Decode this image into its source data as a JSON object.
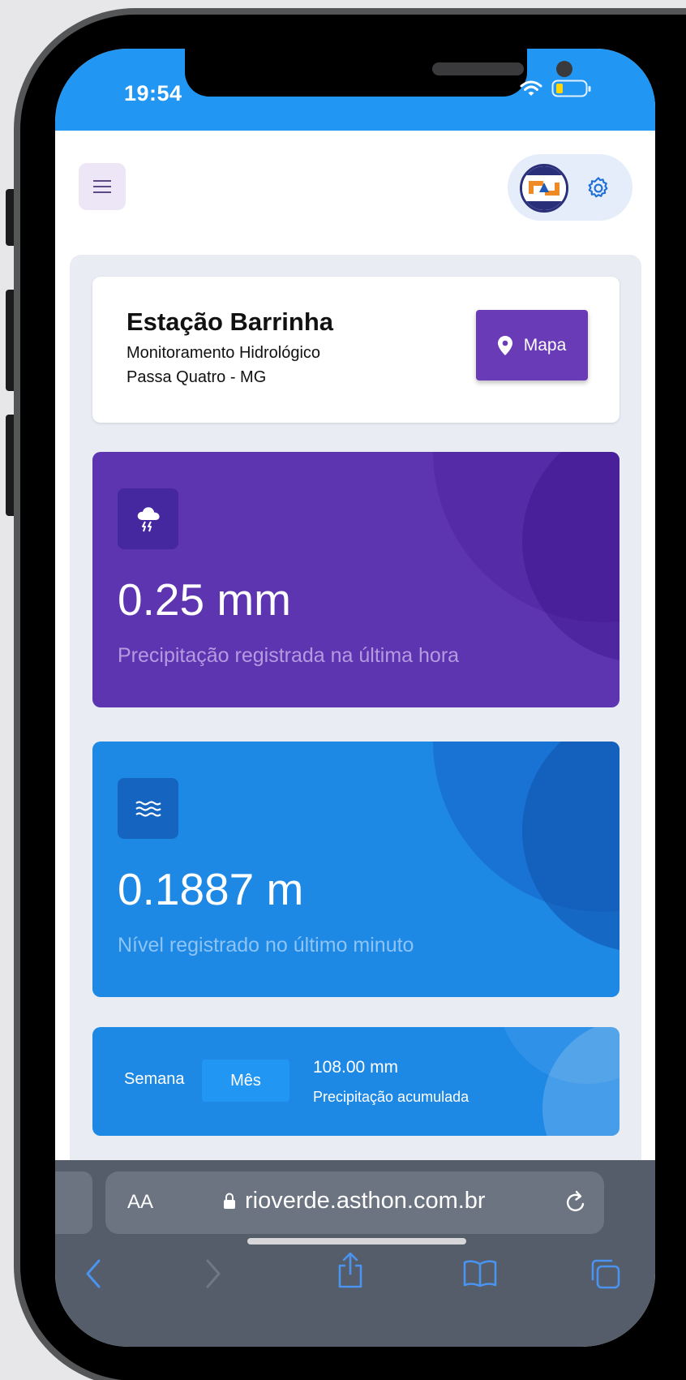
{
  "status_bar": {
    "time": "19:54"
  },
  "station": {
    "name": "Estação Barrinha",
    "subtitle": "Monitoramento Hidrológico",
    "location": "Passa Quatro - MG",
    "map_button": "Mapa"
  },
  "rain_card": {
    "value": "0.25 mm",
    "label": "Precipitação registrada na última hora",
    "icon": "thunderstorm-icon",
    "color": "#5e35b1"
  },
  "level_card": {
    "value": "0.1887 m",
    "label": "Nível registrado no último minuto",
    "icon": "waves-icon",
    "color": "#1e88e5"
  },
  "accumulated": {
    "tabs": [
      "Semana",
      "Mês"
    ],
    "selected_tab": "Mês",
    "value": "108.00 mm",
    "label": "Precipitação acumulada"
  },
  "browser": {
    "text_size_label": "AA",
    "url": "rioverde.asthon.com.br"
  }
}
